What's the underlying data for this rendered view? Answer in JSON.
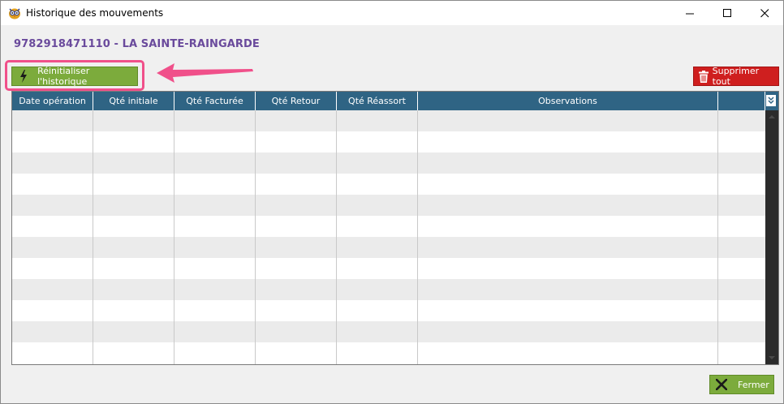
{
  "window": {
    "title": "Historique des mouvements"
  },
  "product": {
    "heading": "9782918471110 - LA SAINTE-RAINGARDE"
  },
  "toolbar": {
    "reset_label": "Réinitialiser l'historique",
    "delete_all_label": "Supprimer tout"
  },
  "table": {
    "columns": [
      "Date opération",
      "Qté initiale",
      "Qté Facturée",
      "Qté Retour",
      "Qté Réassort",
      "Observations",
      ""
    ],
    "rows": []
  },
  "footer": {
    "close_label": "Fermer"
  },
  "colors": {
    "accent_green": "#7cab3c",
    "danger_red": "#cf1f1f",
    "header_blue": "#2f6484",
    "heading_purple": "#6a4a9c",
    "annotation_pink": "#f0508a"
  }
}
